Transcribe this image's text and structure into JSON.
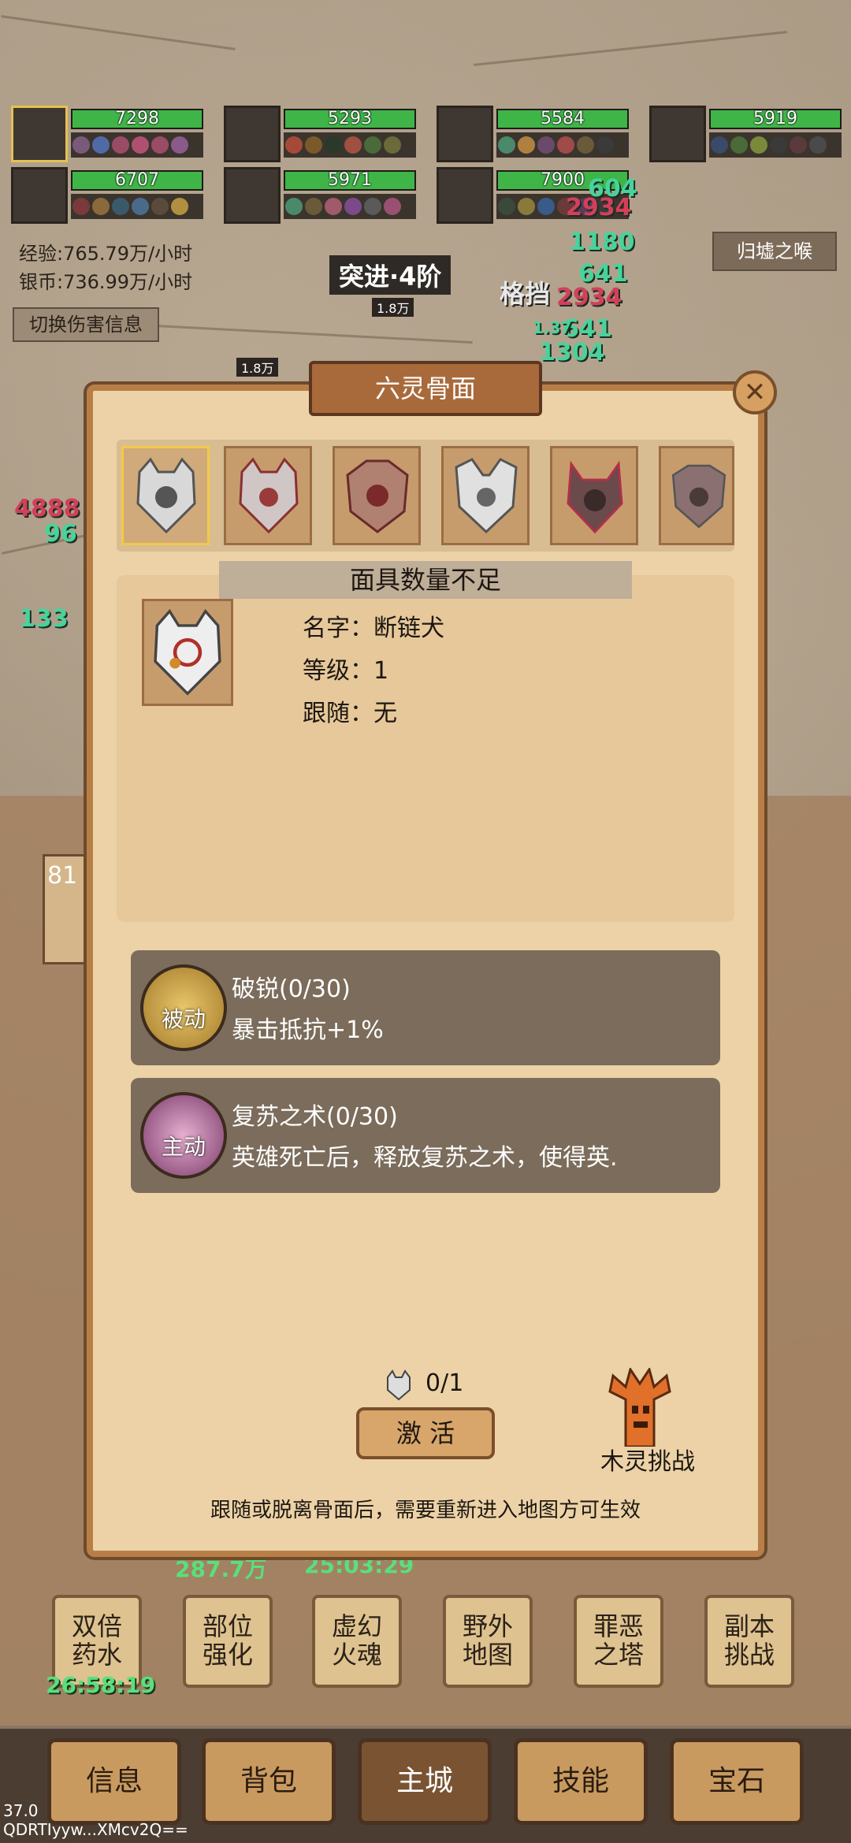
{
  "party": [
    {
      "hp": "7298"
    },
    {
      "hp": "5293"
    },
    {
      "hp": "5584"
    },
    {
      "hp": "5919"
    },
    {
      "hp": "6707"
    },
    {
      "hp": "5971"
    },
    {
      "hp": "7900"
    }
  ],
  "stats": {
    "exp": "经验:765.79万/小时",
    "silver": "银币:736.99万/小时",
    "switch_damage": "切换伤害信息",
    "zone": "归墟之喉"
  },
  "battle": {
    "breakthrough": "突进·4阶",
    "block": "格挡",
    "bar_label": "1.8万"
  },
  "damage_numbers": [
    "604",
    "2934",
    "1180",
    "641",
    "2934",
    "641",
    "1304",
    "1.37",
    "4888",
    "96",
    "133"
  ],
  "modal": {
    "title": "六灵骨面",
    "close": "✕",
    "status": "面具数量不足",
    "name_line": "名字：断链犬",
    "level_line": "等级：1",
    "follow_line": "跟随：无",
    "skills": [
      {
        "tag": "被动",
        "name": "破锐(0/30)",
        "desc": "暴击抵抗+1%"
      },
      {
        "tag": "主动",
        "name": "复苏之术(0/30)",
        "desc": "英雄死亡后，释放复苏之术，使得英."
      }
    ],
    "mask_count": "0/1",
    "activate": "激 活",
    "tree_challenge": "木灵挑战",
    "note": "跟随或脱离骨面后，需要重新进入地图方可生效"
  },
  "background_texts": {
    "partial_a": "81",
    "stat_1": "287.7万",
    "stat_2": "25:03:29"
  },
  "menu": [
    {
      "l1": "双倍",
      "l2": "药水"
    },
    {
      "l1": "部位",
      "l2": "强化"
    },
    {
      "l1": "虚幻",
      "l2": "火魂"
    },
    {
      "l1": "野外",
      "l2": "地图"
    },
    {
      "l1": "罪恶",
      "l2": "之塔"
    },
    {
      "l1": "副本",
      "l2": "挑战"
    }
  ],
  "potion_timer": "26:58:19",
  "tabs": [
    "信息",
    "背包",
    "主城",
    "技能",
    "宝石"
  ],
  "version": "37.0",
  "device_id": "QDRTIyyw...XMcv2Q=="
}
